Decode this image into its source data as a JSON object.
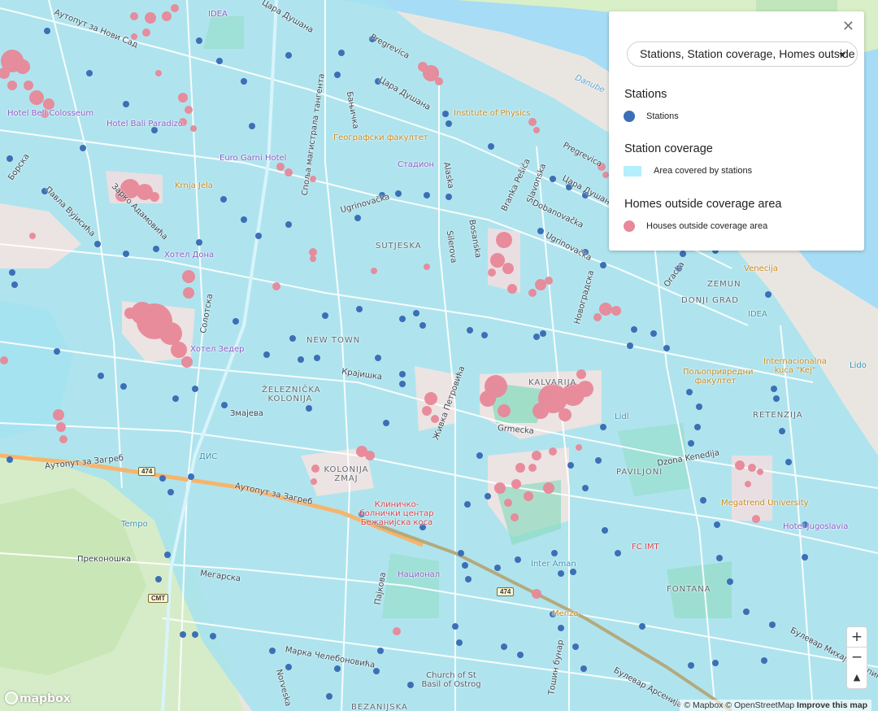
{
  "legend_panel": {
    "close_icon": "✕",
    "layer_select_value": "Stations, Station coverage, Homes outside coverage area",
    "sections": [
      {
        "heading": "Stations",
        "item": "Stations",
        "color": "#3c6fb6",
        "shape": "circle"
      },
      {
        "heading": "Station coverage",
        "item": "Area covered by stations",
        "color": "#b5eefc",
        "shape": "square"
      },
      {
        "heading": "Homes outside coverage area",
        "item": "Houses outside coverage area",
        "color": "#e88899",
        "shape": "circle"
      }
    ]
  },
  "controls": {
    "zoom_in": "+",
    "zoom_out": "−",
    "compass": "▲"
  },
  "branding": {
    "logo": "mapbox"
  },
  "attribution": {
    "mapbox": "© Mapbox",
    "osm": "© OpenStreetMap",
    "improve": "Improve this map"
  },
  "map_labels": {
    "districts": [
      "SUTJESKA",
      "NEW TOWN",
      "ŽELEZNIČKA KOLONIJA",
      "KOLONIJA ZMAJ",
      "KALVARIJA",
      "PAVILJONI",
      "ZEMUN",
      "DONJI GRAD",
      "RETENZIJA",
      "FONTANA",
      "BEZANIJSKA"
    ],
    "streets": [
      "Аутопут за Нови Сад",
      "Цара Душана",
      "Pregrevica",
      "Бањичка",
      "Ugrinovačka",
      "Стара Пазова",
      "Споља магистрала тангента",
      "Борска",
      "Павла Вујисића",
      "Зарко Адамовића",
      "Alaska",
      "Branka Pešića",
      "Slavonska",
      "Dobanovačka",
      "Bosanska",
      "Silerova",
      "Солотска",
      "Крајишка",
      "Змајева",
      "Grmecka",
      "Живка Петровића",
      "Новоградска",
      "Oracka",
      "Dzona Kenedija",
      "Аутопут за Загреб",
      "Преконошка",
      "Мегарска",
      "Пајкова",
      "Марка Челебоновића",
      "Norveska",
      "Тошин бунар",
      "Булевар Арсенија",
      "Булевар Михајла Пупина",
      "Danube"
    ],
    "pois": [
      "IDEA",
      "Hotel Bell Colosseum",
      "Hotel Bali Paradizo",
      "Euro Garni Hotel",
      "Krnja Jela",
      "Хотел Дона",
      "Хотел Зедер",
      "Географски факултет",
      "Стадион",
      "Institute of Physics",
      "Venecija",
      "IDEA",
      "Пољопривредни факултет",
      "Internacionalna kuca \"Kej\"",
      "Lido",
      "Lidl",
      "ДИС",
      "Tempo",
      "Клиничко-болнички центар Бежанијска коса",
      "Национал",
      "Inter Aman",
      "Menza",
      "FC IMT",
      "Megatrend University",
      "Hotel Jugoslavia",
      "Church of St Basil of Ostrog"
    ],
    "shields": [
      "474",
      "474",
      "СМТ"
    ]
  }
}
